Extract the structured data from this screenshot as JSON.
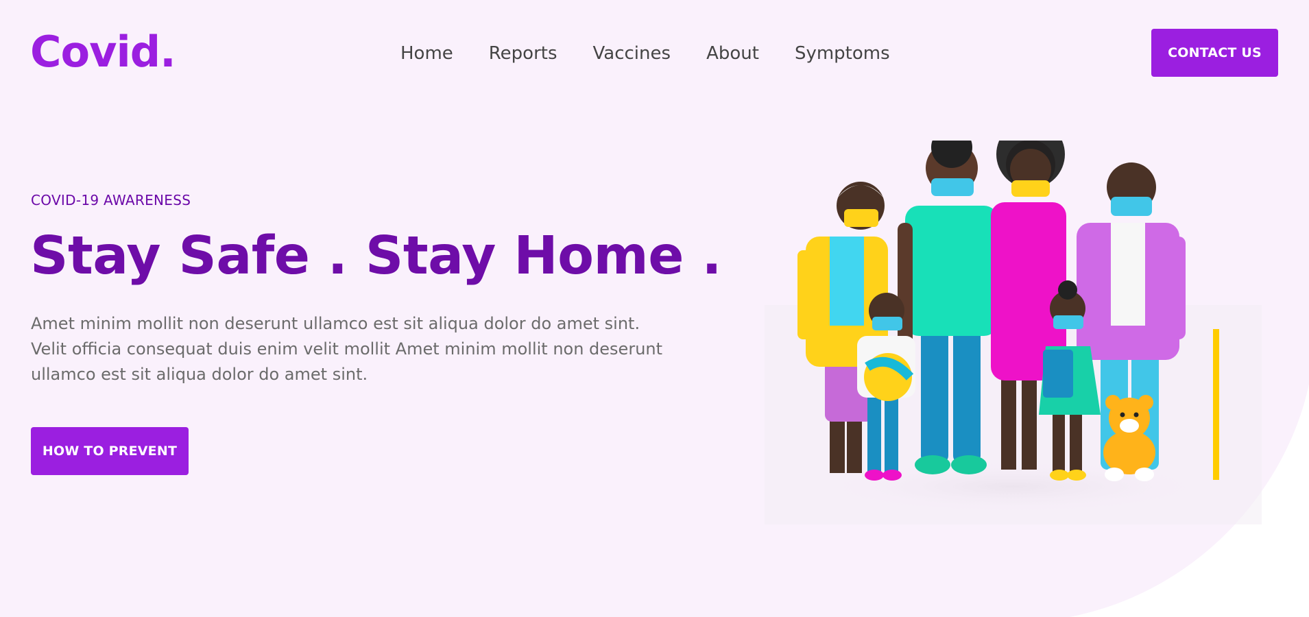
{
  "brand": {
    "logo": "Covid."
  },
  "nav": {
    "items": [
      "Home",
      "Reports",
      "Vaccines",
      "About",
      "Symptoms"
    ]
  },
  "header": {
    "contact_label": "CONTACT US"
  },
  "hero": {
    "eyebrow": "COVID-19 AWARENESS",
    "headline": "Stay Safe . Stay Home .",
    "body": "Amet minim mollit non deserunt ullamco est sit aliqua dolor do amet sint. Velit officia consequat duis enim velit mollit Amet minim mollit non deserunt ullamco est sit aliqua dolor do amet sint.",
    "cta_label": "HOW TO PREVENT"
  },
  "colors": {
    "accent": "#9b1fe0",
    "headline": "#6e0da8",
    "background": "#faf1fc",
    "body_text": "#6b6b6b"
  },
  "illustration": {
    "icon": "family-wearing-masks-illustration"
  }
}
